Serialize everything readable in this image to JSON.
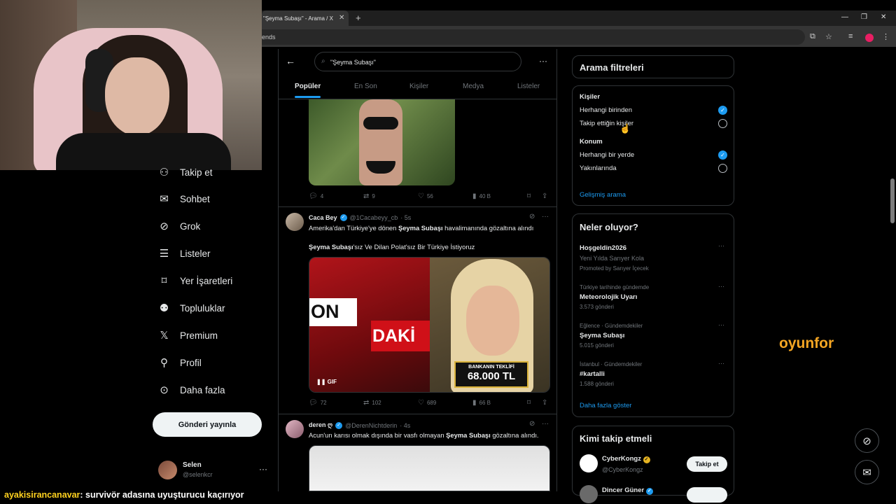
{
  "browser": {
    "tab_title": "\"Şeyma Subaşı\" - Arama / X",
    "tab_close": "✕",
    "new_tab": "+",
    "url_fragment": "ends",
    "window_controls": [
      "—",
      "❐",
      "✕"
    ]
  },
  "sidebar": {
    "items": [
      {
        "label": "Takip et",
        "icon": "person-plus-icon"
      },
      {
        "label": "Sohbet",
        "icon": "mail-icon"
      },
      {
        "label": "Grok",
        "icon": "grok-icon"
      },
      {
        "label": "Listeler",
        "icon": "list-icon"
      },
      {
        "label": "Yer İşaretleri",
        "icon": "bookmark-icon"
      },
      {
        "label": "Topluluklar",
        "icon": "communities-icon"
      },
      {
        "label": "Premium",
        "icon": "x-logo-icon"
      },
      {
        "label": "Profil",
        "icon": "person-icon"
      },
      {
        "label": "Daha fazla",
        "icon": "more-circle-icon"
      }
    ],
    "post_button": "Gönderi yayınla",
    "user": {
      "name": "Selen",
      "handle": "@selenkcr",
      "more": "···"
    }
  },
  "search": {
    "query": "\"Şeyma Subaşı\"",
    "more": "···",
    "tabs": [
      "Popüler",
      "En Son",
      "Kişiler",
      "Medya",
      "Listeler"
    ],
    "active_tab": "Popüler"
  },
  "tweets": [
    {
      "stats": {
        "replies": "4",
        "retweets": "9",
        "likes": "56",
        "views": "40 B"
      }
    },
    {
      "name": "Caca Bey",
      "handle": "@1Cacabeyy_cb",
      "time": "· 5s",
      "text_pre": "Amerika'dan Türkiye'ye dönen ",
      "text_bold": "Şeyma Subaşı",
      "text_post": " havalimanında gözaltına alındı",
      "text2_bold": "Şeyma Subaşı",
      "text2_post": "'sız Ve Dilan Polat'sız Bir Türkiye İstiyoruz",
      "media": {
        "on": "ON",
        "dak": "DAKİ",
        "box_title": "BANKANIN TEKLİFİ",
        "box_value": "68.000 TL",
        "gif": "❚❚  GIF"
      },
      "stats": {
        "replies": "72",
        "retweets": "102",
        "likes": "689",
        "views": "66 B"
      }
    },
    {
      "name": "deren ღ",
      "handle": "@DerenNichtderin",
      "time": "· 4s",
      "text_pre": "Acun'un karısı olmak dışında bir vasfı olmayan ",
      "text_bold": "Şeyma Subaşı",
      "text_post": " gözaltına alındı."
    }
  ],
  "filters": {
    "title": "Arama filtreleri",
    "people_label": "Kişiler",
    "people_options": [
      "Herhangi birinden",
      "Takip ettiğin kişiler"
    ],
    "people_selected": 0,
    "location_label": "Konum",
    "location_options": [
      "Herhangi bir yerde",
      "Yakınlarında"
    ],
    "location_selected": 0,
    "advanced": "Gelişmiş arama"
  },
  "trends": {
    "title": "Neler oluyor?",
    "promoted": {
      "title": "Hoşgeldin2026",
      "subtitle": "Yeni Yılda Sarıyer Kola",
      "promoted_by": "Promoted by Sarıyer İçecek"
    },
    "items": [
      {
        "meta": "Türkiye tarihinde gündemde",
        "title": "Meteorolojik Uyarı",
        "count": "3.573 gönderi"
      },
      {
        "meta": "Eğlence · Gündemdekiler",
        "title": "Şeyma Subaşı",
        "count": "5.015 gönderi"
      },
      {
        "meta": "İstanbul · Gündemdekiler",
        "title": "#kartalli",
        "count": "1.588 gönderi"
      }
    ],
    "show_more": "Daha fazla göster"
  },
  "who_to_follow": {
    "title": "Kimi takip etmeli",
    "accounts": [
      {
        "name": "CyberKongz",
        "handle": "@CyberKongz",
        "button": "Takip et"
      },
      {
        "name": "Dincer Güner",
        "handle": "",
        "button": ""
      }
    ]
  },
  "overlay": {
    "watermark": "oyunfor",
    "chat_user": "ayakisirancanavar",
    "chat_message": ": survivör adasına uyuşturucu kaçırıyor"
  },
  "colors": {
    "accent": "#1d9bf0",
    "background": "#000000",
    "watermark": "#f5a623",
    "chat_user": "#ffd21f"
  }
}
